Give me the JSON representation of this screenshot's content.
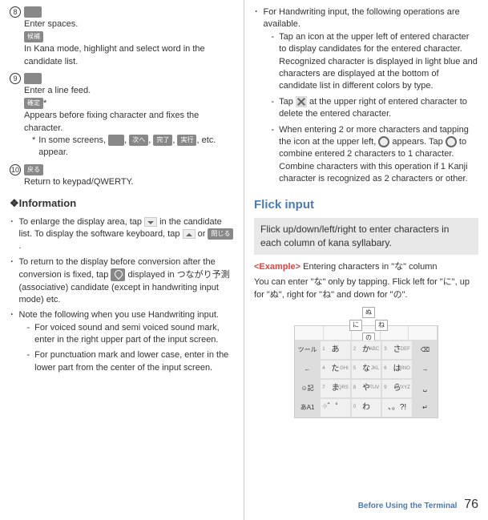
{
  "left": {
    "items": [
      {
        "num": "8",
        "icon": true,
        "line1": "Enter spaces.",
        "icon2_label": "候補",
        "line2": "In Kana mode, highlight and select word in the candidate list."
      },
      {
        "num": "9",
        "icon": true,
        "line1": "Enter a line feed.",
        "icon2_label": "確定",
        "icon2_suffix": "*",
        "line2": "Appears before fixing character and fixes the character.",
        "note_prefix": "*",
        "note": "In some screens, ",
        "note_icons": [
          "",
          "次へ",
          "完了",
          "実行"
        ],
        "note_suffix": ", etc. appear."
      },
      {
        "num": "10",
        "icon_label": "戻る",
        "line1": "Return to keypad/QWERTY."
      }
    ],
    "info_header": "❖Information",
    "info": [
      {
        "text_a": "To enlarge the display area, tap ",
        "mid_icon": "chevron-down",
        "text_b": " in the candidate list. To display the software keyboard, tap ",
        "end_icon": "chevron-up",
        "text_c": " or ",
        "end_icon2_label": "閉じる",
        "text_d": "."
      },
      {
        "text_a": "To return to the display before conversion after the conversion is fixed, tap ",
        "mid_icon": "cancel",
        "text_b": " displayed in つながり予測 (associative) candidate (except in handwriting input mode) etc."
      },
      {
        "text_a": "Note the following when you use Handwriting input.",
        "sub": [
          "For voiced sound and semi voiced sound mark, enter in the right upper part of the input screen.",
          "For punctuation mark and lower case, enter in the lower part from the center of the input screen."
        ]
      }
    ]
  },
  "right": {
    "top_bullet": "For Handwriting input, the following operations are available.",
    "top_sub": [
      "Tap an icon at the upper left of entered character to display candidates for the entered character. Recognized character is displayed in light blue and characters are displayed at the bottom of candidate list in different colors by type.",
      {
        "a": "Tap ",
        "icon": "x",
        "b": " at the upper right of entered character to delete the entered character."
      },
      {
        "a": "When entering 2 or more characters and tapping the icon at the upper left, ",
        "icon1": "circle",
        "b": " appears. Tap ",
        "icon2": "circle",
        "c": " to combine entered 2 characters to 1 character. Combine characters with this operation if 1 Kanji character is recognized as 2 characters or other."
      }
    ],
    "section_title": "Flick input",
    "section_subtitle": "Flick up/down/left/right to enter characters in each column of kana syllabary.",
    "example_label": "<Example>",
    "example_text": " Entering characters in \"な\" column",
    "example_body": "You can enter \"な\" only by tapping. Flick left for \"に\", up for \"ぬ\", right for \"ね\" and down for \"の\".",
    "keypad": {
      "flick": {
        "up": "ぬ",
        "left": "に",
        "right": "ね",
        "down": "の",
        "center": "な"
      },
      "rows": [
        {
          "side_l": "ツール",
          "cells": [
            {
              "m": "あ",
              "s": "1"
            },
            {
              "m": "か",
              "s": "2",
              "r": "ABC"
            },
            {
              "m": "さ",
              "s": "3",
              "r": "DEF"
            }
          ],
          "side_r": "⌫"
        },
        {
          "side_l": "←",
          "cells": [
            {
              "m": "た",
              "s": "4",
              "r": "GHI"
            },
            {
              "m": "な",
              "s": "5",
              "r": "JKL"
            },
            {
              "m": "は",
              "s": "6",
              "r": "MNO"
            }
          ],
          "side_r": "→"
        },
        {
          "side_l": "☺記",
          "cells": [
            {
              "m": "ま",
              "s": "7",
              "r": "PQRS"
            },
            {
              "m": "や",
              "s": "8",
              "r": "TUV"
            },
            {
              "m": "ら",
              "s": "9",
              "r": "WXYZ"
            }
          ],
          "side_r": "␣"
        },
        {
          "side_l": "あA1",
          "cells": [
            {
              "m": "゛゜",
              "s": "小"
            },
            {
              "m": "わ",
              "s": "0"
            },
            {
              "m": "、。?!",
              "s": ""
            }
          ],
          "side_r": "↵"
        }
      ]
    }
  },
  "footer": {
    "label": "Before Using the Terminal",
    "page": "76"
  }
}
